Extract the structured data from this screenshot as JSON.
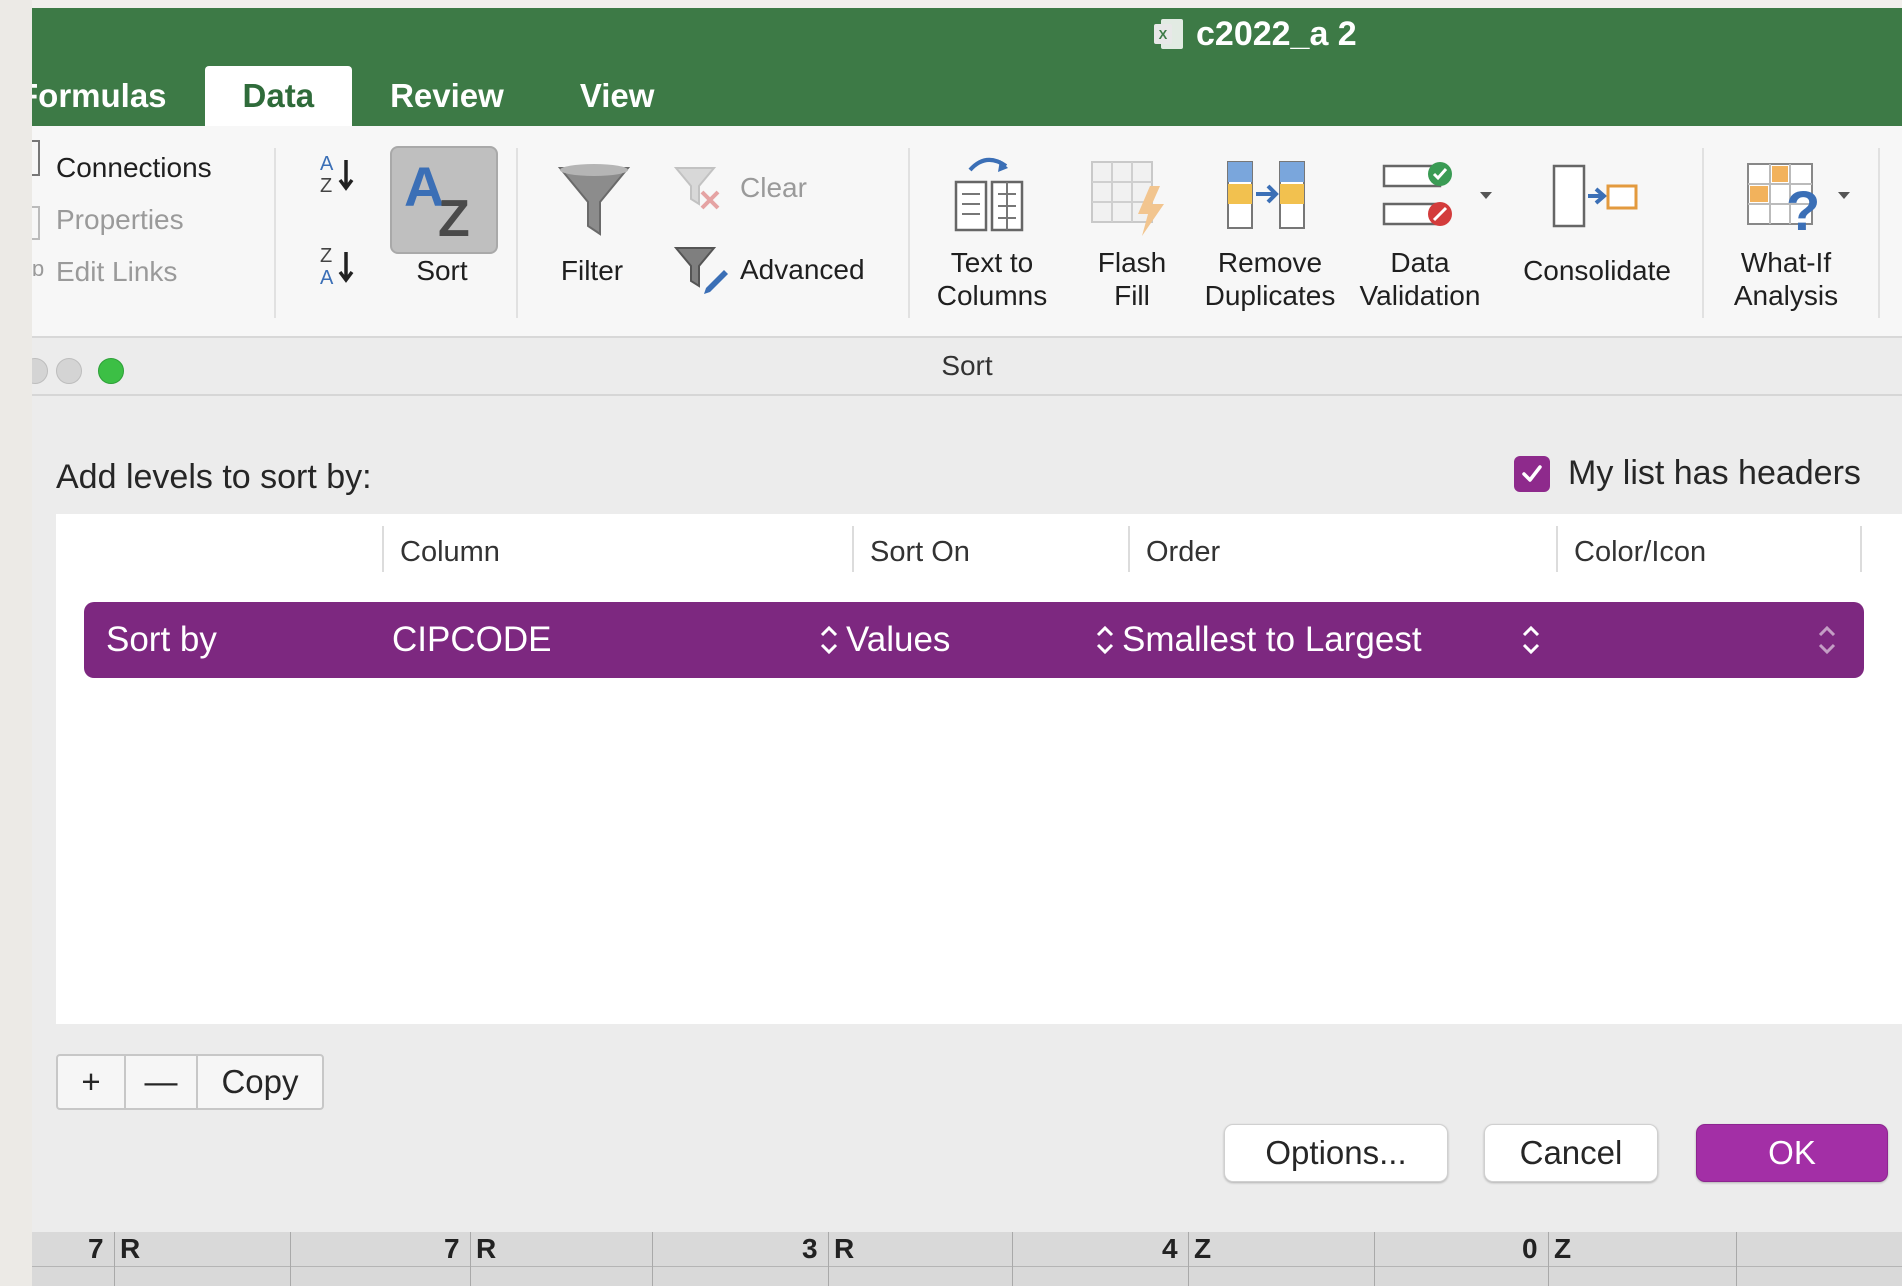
{
  "window": {
    "document_title": "c2022_a 2"
  },
  "ribbon_tabs": [
    {
      "label": "Formulas",
      "active": false
    },
    {
      "label": "Data",
      "active": true
    },
    {
      "label": "Review",
      "active": false
    },
    {
      "label": "View",
      "active": false
    }
  ],
  "ribbon": {
    "connections": "Connections",
    "properties": "Properties",
    "edit_links": "Edit Links",
    "sort": "Sort",
    "filter": "Filter",
    "clear": "Clear",
    "advanced": "Advanced",
    "text_to_columns": [
      "Text to",
      "Columns"
    ],
    "flash_fill": [
      "Flash",
      "Fill"
    ],
    "remove_duplicates": [
      "Remove",
      "Duplicates"
    ],
    "data_validation": [
      "Data",
      "Validation"
    ],
    "consolidate": "Consolidate",
    "what_if": [
      "What-If",
      "Analysis"
    ]
  },
  "dialog": {
    "title": "Sort",
    "add_levels_label": "Add levels to sort by:",
    "headers_checkbox": {
      "label": "My list has headers",
      "checked": true
    },
    "columns": [
      "Column",
      "Sort On",
      "Order",
      "Color/Icon"
    ],
    "rows": [
      {
        "label": "Sort by",
        "column": "CIPCODE",
        "sort_on": "Values",
        "order": "Smallest to Largest",
        "color_icon": ""
      }
    ],
    "add_symbol": "+",
    "remove_symbol": "—",
    "copy": "Copy",
    "options": "Options...",
    "cancel": "Cancel",
    "ok": "OK"
  },
  "sheet_row": [
    "7",
    "R",
    "7",
    "R",
    "3",
    "R",
    "4",
    "Z",
    "0",
    "Z"
  ],
  "colors": {
    "ribbon_green": "#3d7a46",
    "accent_purple": "#7d2880",
    "ok_purple": "#a32fa6"
  }
}
